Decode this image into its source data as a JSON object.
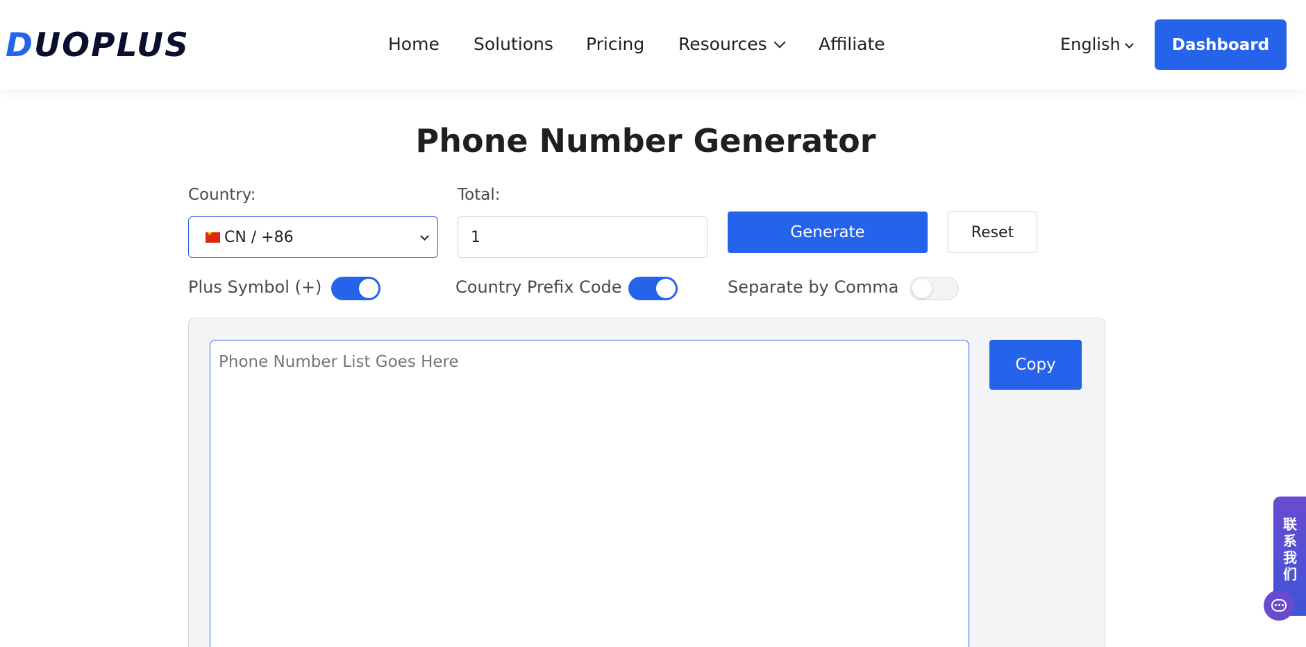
{
  "header": {
    "logo_text": "DUOPLUS",
    "nav": [
      {
        "label": "Home"
      },
      {
        "label": "Solutions"
      },
      {
        "label": "Pricing"
      },
      {
        "label": "Resources"
      },
      {
        "label": "Affiliate"
      }
    ],
    "language": "English",
    "dashboard_label": "Dashboard"
  },
  "title": "Phone Number Generator",
  "form": {
    "country_label": "Country:",
    "country_value": "CN / +86",
    "total_label": "Total:",
    "total_value": "1",
    "generate_label": "Generate",
    "reset_label": "Reset"
  },
  "toggles": [
    {
      "label": "Plus Symbol (+)",
      "on": true
    },
    {
      "label": "Country Prefix Code",
      "on": true
    },
    {
      "label": "Separate by Comma",
      "on": false
    }
  ],
  "output": {
    "placeholder": "Phone Number List Goes Here",
    "copy_label": "Copy"
  },
  "contact_widget": {
    "text": "联系我们"
  },
  "colors": {
    "accent": "#2563eb",
    "contact_gradient_top": "#6a4bd0"
  }
}
